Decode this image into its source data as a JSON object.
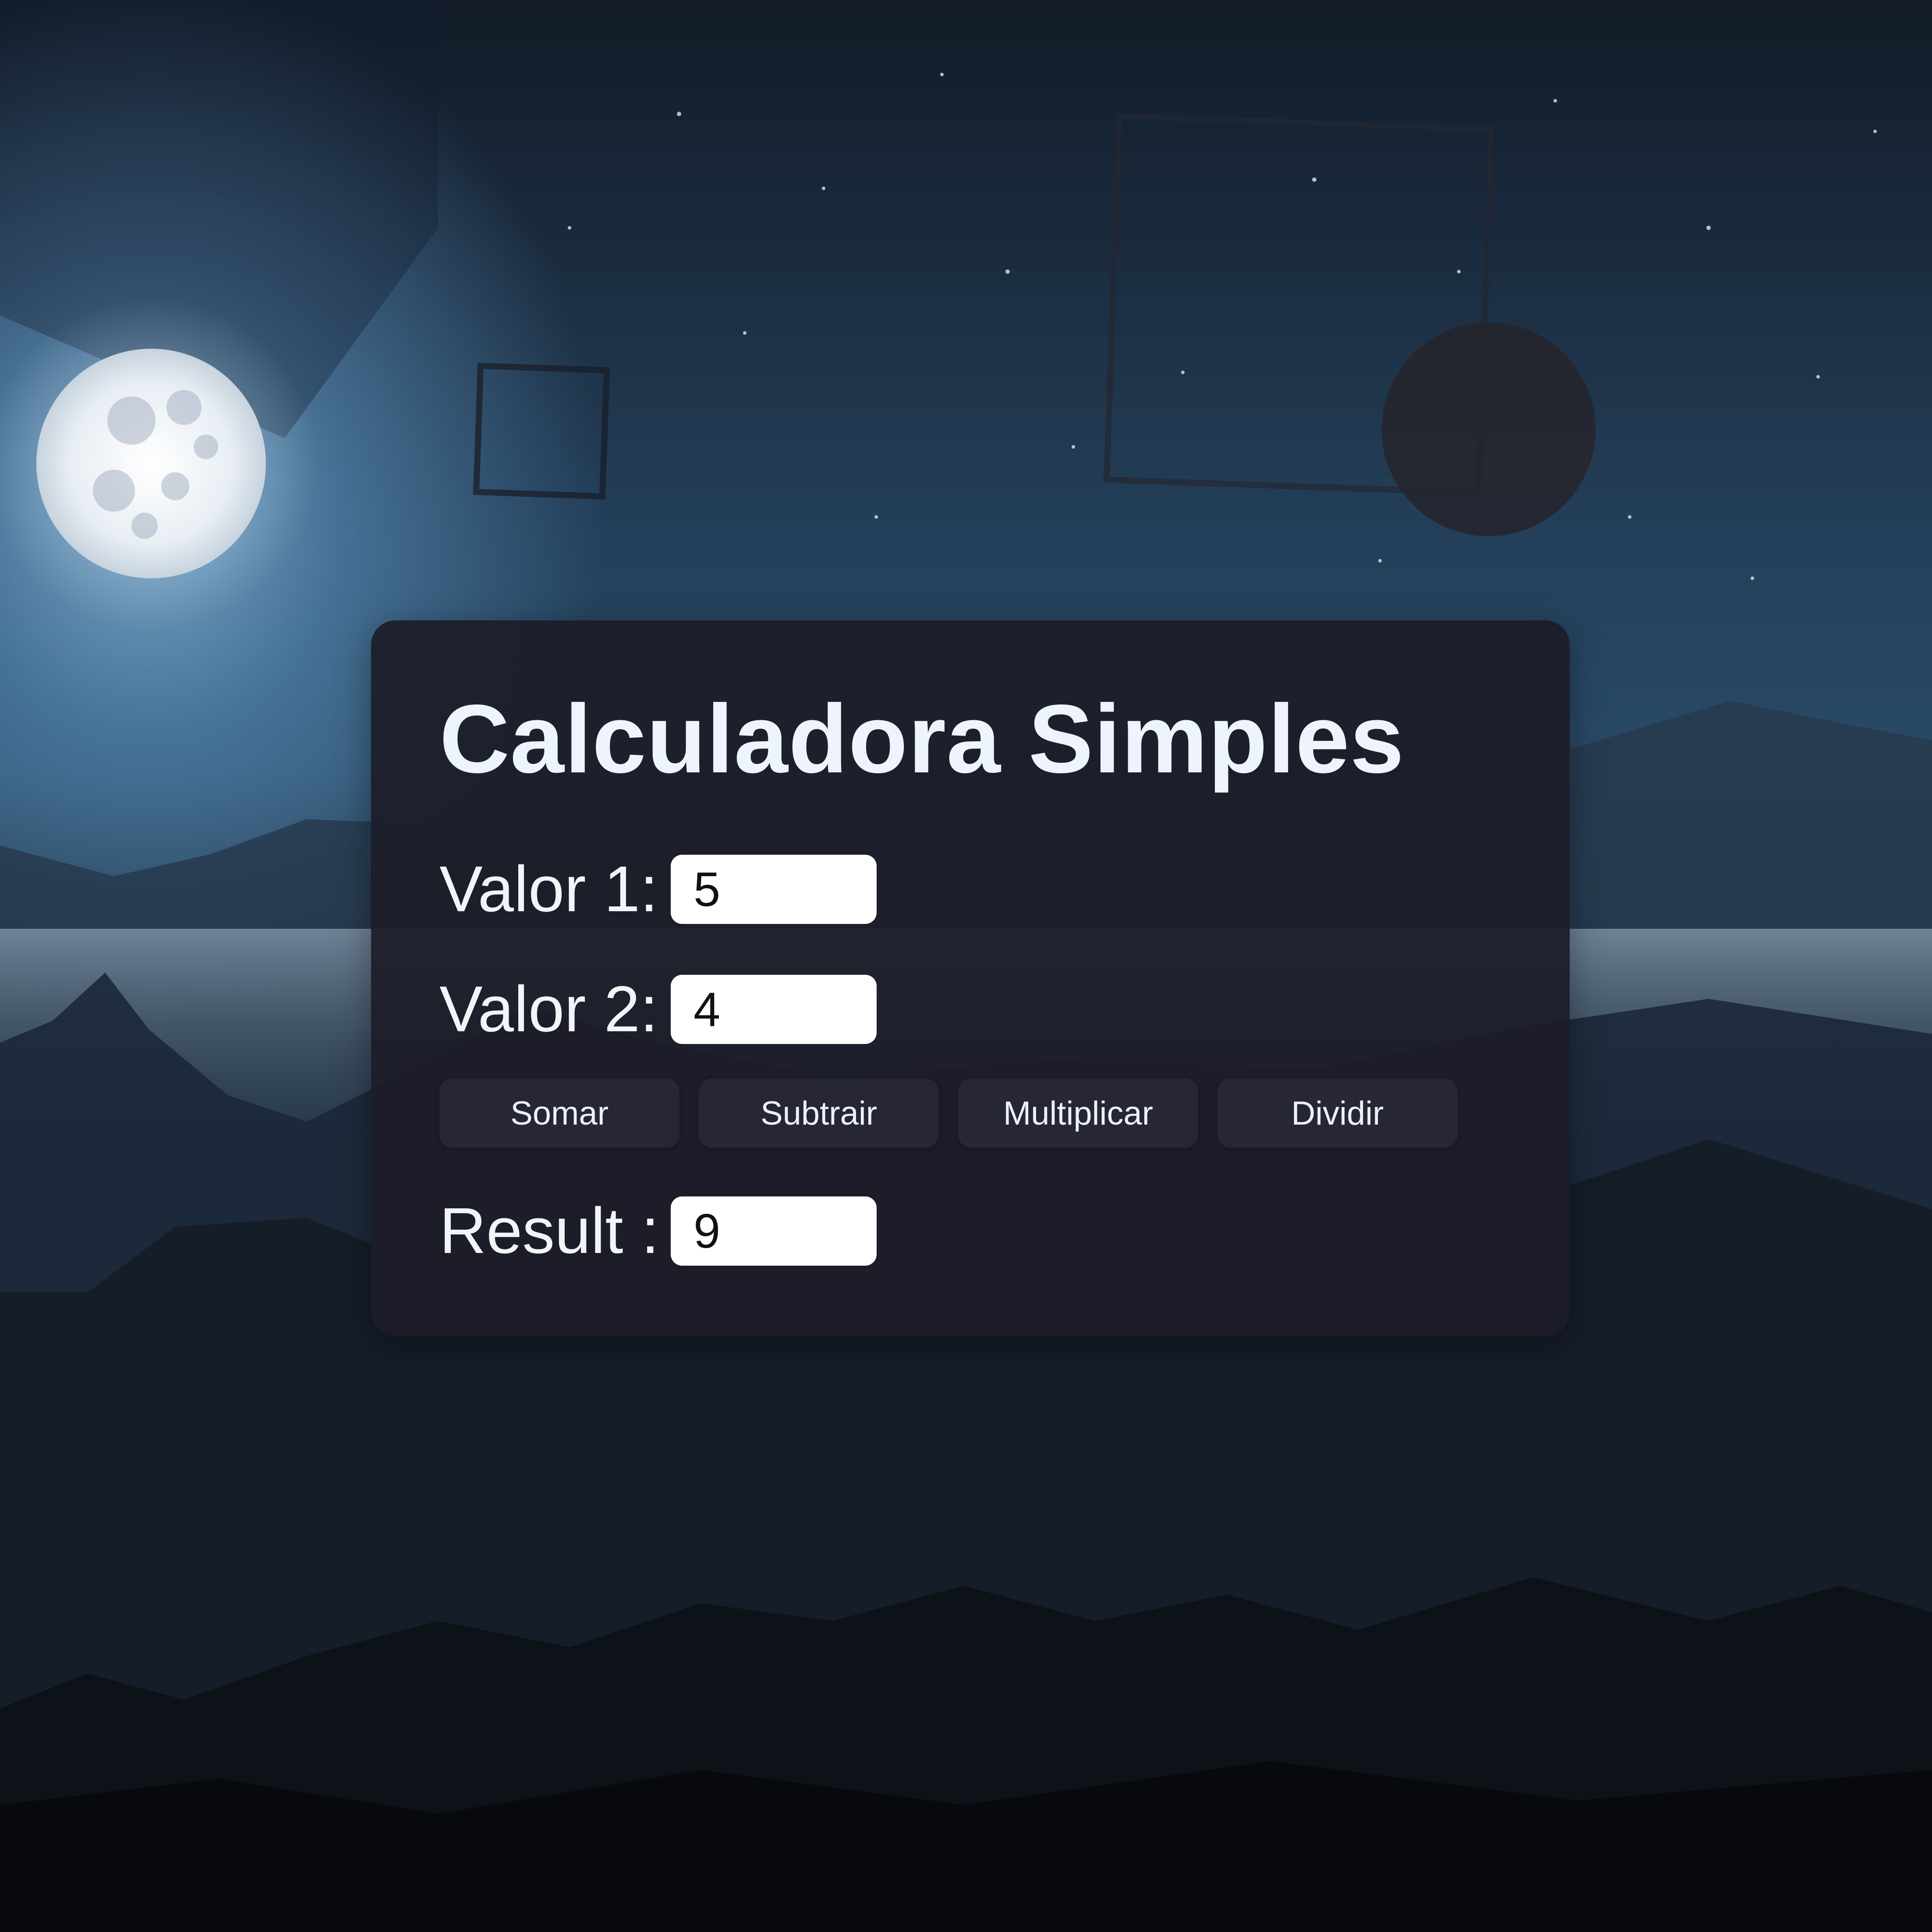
{
  "calculator": {
    "title": "Calculadora Simples",
    "value1": {
      "label": "Valor 1:",
      "value": "5"
    },
    "value2": {
      "label": "Valor 2:",
      "value": "4"
    },
    "buttons": {
      "add": "Somar",
      "subtract": "Subtrair",
      "multiply": "Multiplicar",
      "divide": "Dividir"
    },
    "result": {
      "label": "Result :",
      "value": "9"
    }
  },
  "colors": {
    "panel": "#1c1c28",
    "button": "#262636",
    "title": "#eef4fb",
    "text": "#f2f5f8",
    "field": "#ffffff"
  }
}
